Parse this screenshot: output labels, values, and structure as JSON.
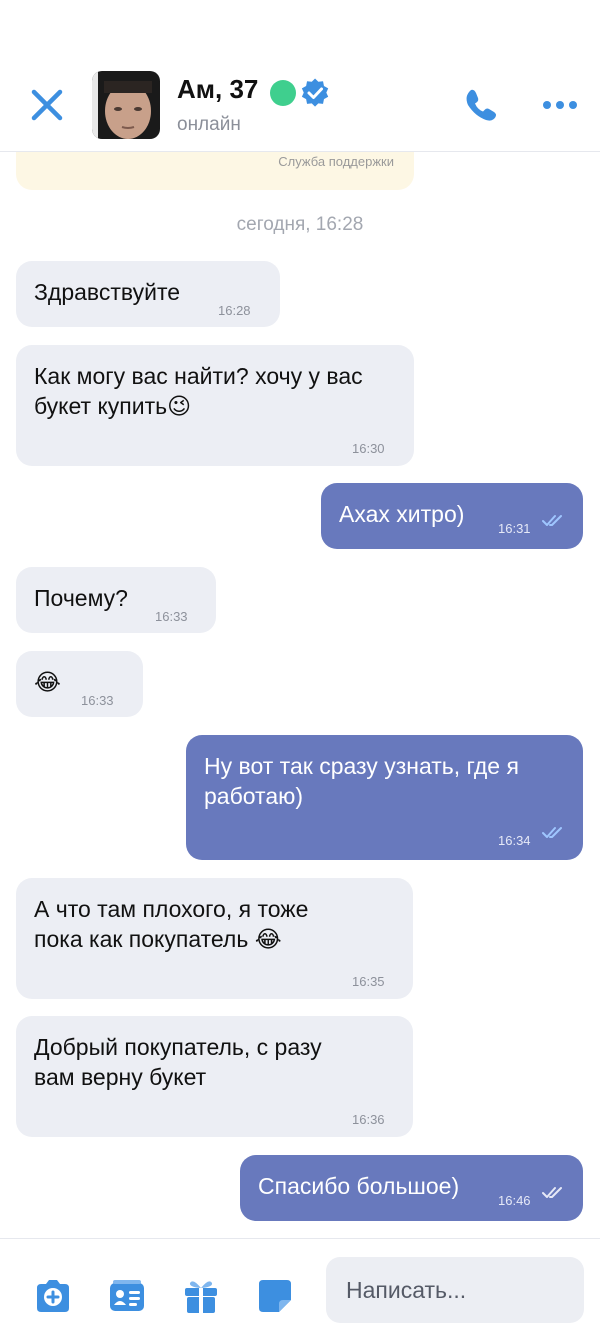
{
  "header": {
    "name": "Ам, 37",
    "status": "онлайн"
  },
  "support_card": {
    "label": "Служба поддержки"
  },
  "date_separator": "сегодня, 16:28",
  "messages": [
    {
      "dir": "in",
      "text": "Здравствуйте",
      "time": "16:28"
    },
    {
      "dir": "in",
      "text": "Как могу вас найти? хочу у вас букет купить😉",
      "time": "16:30"
    },
    {
      "dir": "out",
      "text": "Ахах хитро)",
      "time": "16:31"
    },
    {
      "dir": "in",
      "text": "Почему?",
      "time": "16:33"
    },
    {
      "dir": "in",
      "text": "😂",
      "time": "16:33"
    },
    {
      "dir": "out",
      "text": "Ну вот так сразу узнать, где я работаю)",
      "time": "16:34"
    },
    {
      "dir": "in",
      "text": "А что там плохого, я тоже пока как покупатель 😂",
      "time": "16:35"
    },
    {
      "dir": "in",
      "text": "Добрый покупатель, с разу вам верну букет",
      "time": "16:36"
    },
    {
      "dir": "out",
      "text": "Спасибо большое)",
      "time": "16:46"
    }
  ],
  "composer": {
    "placeholder": "Написать..."
  },
  "colors": {
    "accent": "#3d8fe0",
    "outgoing_bubble": "#6879bd",
    "incoming_bubble": "#eceef4",
    "online": "#3fcf8e"
  },
  "icons": [
    "close-icon",
    "verified-icon",
    "phone-icon",
    "more-icon",
    "camera-icon",
    "contact-card-icon",
    "gift-icon",
    "sticker-icon",
    "read-ticks-icon"
  ]
}
